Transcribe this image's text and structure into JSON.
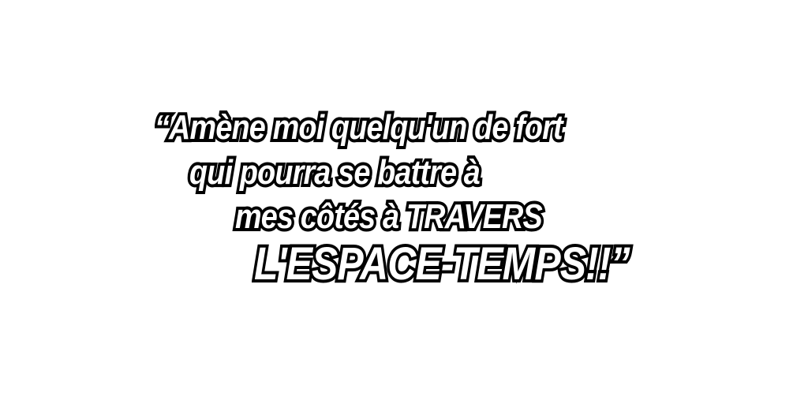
{
  "quote": {
    "lines": [
      "“Amène moi quelqu'un de fort",
      "qui pourra se battre à",
      "mes côtés à TRAVERS",
      "L'ESPACE-TEMPS!!”"
    ]
  },
  "colors": {
    "background": "#ffffff",
    "text_fill": "#ffffff",
    "text_outline": "#000000"
  }
}
